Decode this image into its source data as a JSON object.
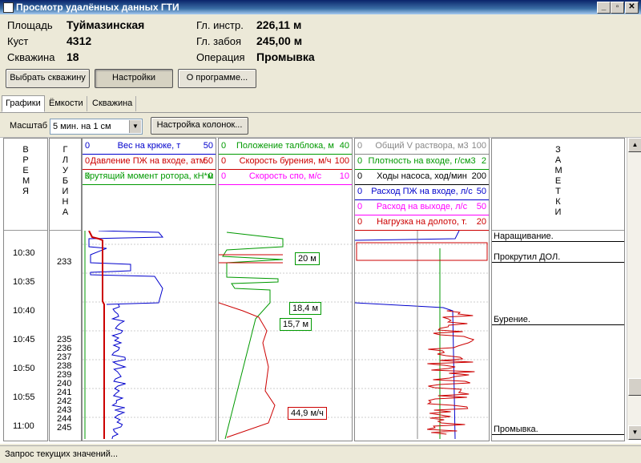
{
  "window": {
    "title": "Просмотр удалённых данных ГТИ",
    "controls": [
      "_",
      "▫",
      "✕"
    ]
  },
  "info": {
    "area_label": "Площадь",
    "area_value": "Туймазинская",
    "cluster_label": "Куст",
    "cluster_value": "4312",
    "well_label": "Скважина",
    "well_value": "18",
    "depth_label": "Гл. инстр.",
    "depth_value": "226,11 м",
    "bottom_label": "Гл. забоя",
    "bottom_value": "245,00 м",
    "op_label": "Операция",
    "op_value": "Промывка"
  },
  "buttons": {
    "select_well": "Выбрать скважину",
    "settings": "Настройки",
    "about": "О программе..."
  },
  "tabs": [
    "Графики",
    "Ёмкости",
    "Скважина"
  ],
  "toolbar": {
    "scale_label": "Масштаб",
    "scale_value": "5 мин. на 1 см",
    "columns_button": "Настройка колонок..."
  },
  "columns": {
    "time_title": "ВРЕМЯ",
    "depth_title": "ГЛУБИНА",
    "notes_title": "ЗАМЕТКИ"
  },
  "track1": [
    {
      "lo": "0",
      "name": "Вес на крюке, т",
      "hi": "50",
      "color": "#0000cc"
    },
    {
      "lo": "0",
      "name": "Давление ПЖ на входе, атм.",
      "hi": "50",
      "color": "#cc0000"
    },
    {
      "lo": "0",
      "name": "Крутящий момент ротора, кН*м",
      "hi": "0",
      "color": "#009900"
    }
  ],
  "track2": [
    {
      "lo": "0",
      "name": "Положение талблока, м",
      "hi": "40",
      "color": "#009900"
    },
    {
      "lo": "0",
      "name": "Скорость бурения, м/ч",
      "hi": "100",
      "color": "#cc0000"
    },
    {
      "lo": "0",
      "name": "Скорость спо, м/с",
      "hi": "10",
      "color": "#ff00ff"
    }
  ],
  "track3": [
    {
      "lo": "0",
      "name": "Общий V раствора, м3",
      "hi": "100",
      "color": "#888888"
    },
    {
      "lo": "0",
      "name": "Плотность на входе, г/см3",
      "hi": "2",
      "color": "#009900"
    },
    {
      "lo": "0",
      "name": "Ходы насоса, ход/мин",
      "hi": "200",
      "color": "#000000"
    },
    {
      "lo": "0",
      "name": "Расход ПЖ на входе, л/с",
      "hi": "50",
      "color": "#0000cc"
    },
    {
      "lo": "0",
      "name": "Расход на выходе, л/с",
      "hi": "50",
      "color": "#ff00ff"
    },
    {
      "lo": "0",
      "name": "Нагрузка на долото, т.",
      "hi": "20",
      "color": "#cc0000"
    }
  ],
  "time_ticks": [
    "10:30",
    "10:35",
    "10:40",
    "10:45",
    "10:50",
    "10:55",
    "11:00"
  ],
  "depth_ticks": [
    "233",
    "235",
    "236",
    "237",
    "238",
    "239",
    "240",
    "241",
    "242",
    "243",
    "244",
    "245"
  ],
  "callouts": [
    "20 м",
    "18,4 м",
    "15,7 м",
    "44,9 м/ч"
  ],
  "notes": [
    "Наращивание.",
    "Прокрутил ДОЛ.",
    "Бурение.",
    "Промывка."
  ],
  "status": "Запрос текущих значений..."
}
